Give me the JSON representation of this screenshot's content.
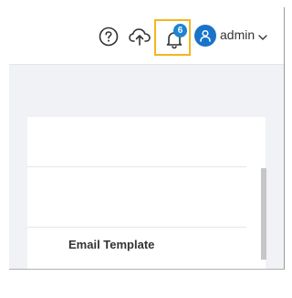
{
  "header": {
    "help_icon": "question-circle-icon",
    "upload_icon": "cloud-upload-icon",
    "notification_icon": "bell-icon",
    "notification_count": "6",
    "highlight_color": "#f5b51d",
    "badge_color": "#1e82d6",
    "avatar_icon": "user-icon",
    "avatar_color": "#1a73c9",
    "username": "admin",
    "user_menu_icon": "chevron-down-icon"
  },
  "main": {
    "table": {
      "columns": [
        "Email Template"
      ]
    }
  }
}
